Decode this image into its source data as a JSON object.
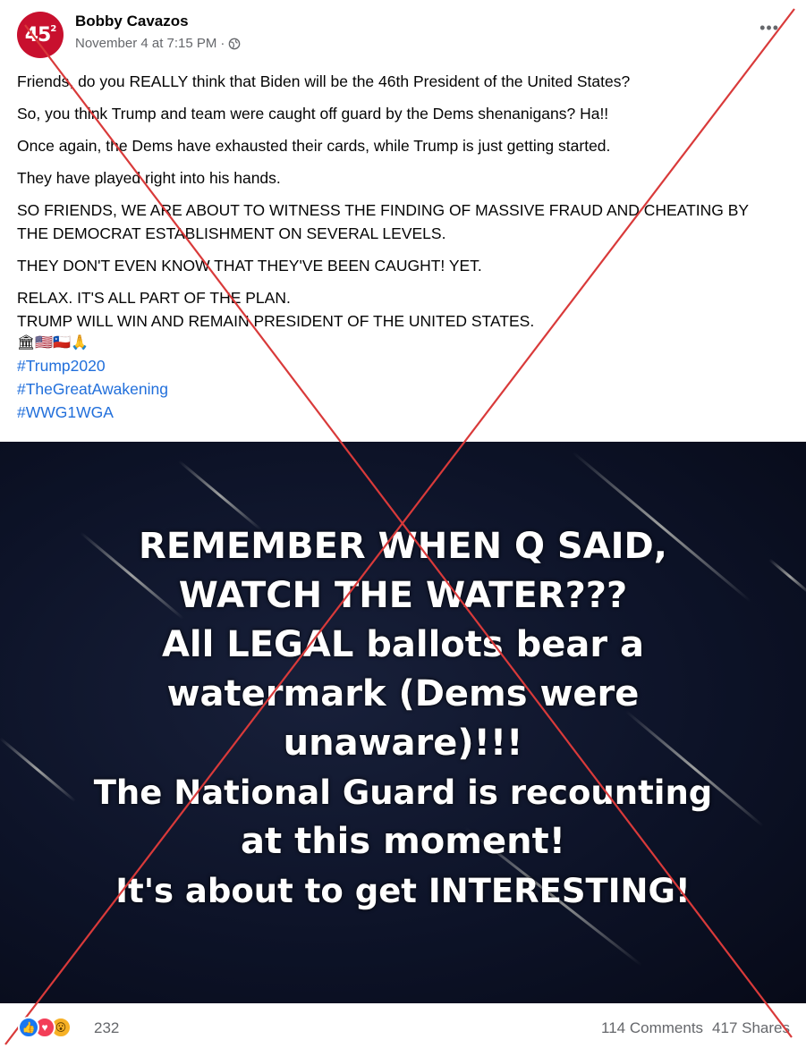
{
  "post": {
    "author": "Bobby Cavazos",
    "avatar_text": "45",
    "avatar_sup": "2",
    "timestamp": "November 4 at 7:15 PM",
    "separator": "·",
    "privacy_icon": "globe-icon",
    "more_label": "•••"
  },
  "body": {
    "p1": "Friends, do you REALLY think that Biden will be the 46th President of the United States?",
    "p2": "So, you think Trump and team were caught off guard by the Dems shenanigans?  Ha!!",
    "p3": "Once again, the Dems have exhausted their cards, while Trump is just getting started.",
    "p4": "They have played right into his hands.",
    "p5": "SO FRIENDS, WE ARE ABOUT TO WITNESS THE FINDING OF MASSIVE FRAUD AND CHEATING BY THE DEMOCRAT ESTABLISHMENT ON SEVERAL LEVELS.",
    "p6": "THEY DON'T EVEN KNOW THAT THEY'VE BEEN CAUGHT!  YET.",
    "p7a": "RELAX. IT'S ALL PART OF THE PLAN.",
    "p7b": "TRUMP WILL WIN AND REMAIN PRESIDENT OF THE UNITED STATES.",
    "emojis": "🏛🇺🇸🇨🇱🙏",
    "hashtags": [
      "#Trump2020",
      "#TheGreatAwakening",
      "#WWG1WGA"
    ]
  },
  "image": {
    "lines": [
      "REMEMBER WHEN Q SAID,",
      "WATCH THE WATER???",
      "All LEGAL ballots bear a",
      "watermark (Dems were",
      "unaware)!!!",
      "The National Guard is recounting",
      "at this moment!",
      "It's about to get INTERESTING!"
    ]
  },
  "footer": {
    "reaction_icons": [
      "like-icon",
      "love-icon",
      "wow-icon"
    ],
    "reaction_count": "232",
    "comments": "114 Comments",
    "shares": "417 Shares"
  },
  "colors": {
    "hashtag": "#216fdb",
    "cross": "#d93a3a",
    "image_bg": "#0d1328"
  }
}
